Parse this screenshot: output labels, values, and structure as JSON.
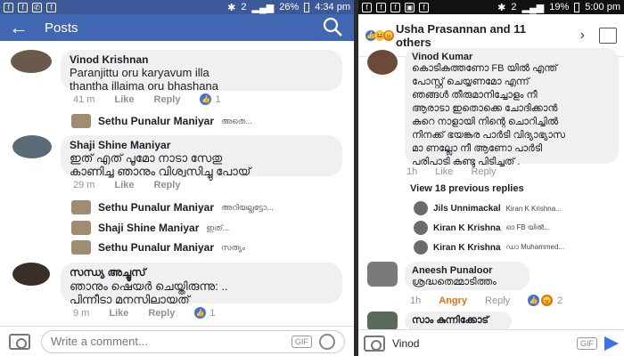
{
  "left": {
    "status": {
      "battery": "26%",
      "time": "4:34 pm",
      "sim": "2"
    },
    "appbar": {
      "title": "Posts"
    },
    "comments": [
      {
        "name": "Vinod Krishnan",
        "text1": "Paranjittu oru karyavum illa",
        "text2": "thantha illaima oru bhashana",
        "time": "41 m",
        "like": "Like",
        "reply": "Reply",
        "count": "1"
      },
      {
        "name": "Shaji Shine Maniyar",
        "text1": "ഇത് എത് പൂമോ നാടാ സേതു",
        "text2": "കാണിച്ച ഞാനും വിശ്വസിച്ചു പോയ്",
        "time": "29 m",
        "like": "Like",
        "reply": "Reply"
      },
      {
        "name": "സന്ധ്യ അച്ചൂസ്",
        "text1": "ഞാനും ഷെയർ ചെയ്തിരുന്നു: ..",
        "text2": "പിന്നീടാ മനസിലായത്",
        "time": "9 m",
        "like": "Like",
        "reply": "Reply",
        "count": "1"
      }
    ],
    "replies": [
      {
        "name": "Sethu Punalur Maniyar",
        "text": "അതെ..."
      },
      {
        "name": "Sethu Punalur Maniyar",
        "text": "അറിയല്ലട്ടോ..."
      },
      {
        "name": "Shaji Shine Maniyar",
        "text": "ഇത്..."
      },
      {
        "name": "Sethu Punalur Maniyar",
        "text": "സത്യം"
      }
    ],
    "composer": {
      "placeholder": "Write a comment...",
      "gif": "GIF"
    }
  },
  "right": {
    "status": {
      "battery": "19%",
      "time": "5:00 pm",
      "sim": "2"
    },
    "header": {
      "title": "Usha Prasannan and 11 others"
    },
    "main_comment": {
      "name": "Vinod Kumar",
      "lines": [
        "കൊടികുത്തണോ FB യിൽ എന്ത്",
        "പോസ്റ്റ് ചെയ്യണമോ എന്ന്",
        "ഞങ്ങൾ തീരുമാനിച്ചോളം  നീ",
        "ആരാടാ ഇതൊക്കെ ചോദിക്കാൻ",
        "കുറെ നാളായി നിന്റെ ചൊറിച്ചിൽ",
        "നിനക്ക് ഭയങ്കര പാർടി വിദ്യാഭ്യാസ",
        "മാ ണല്ലോ നീ ആണോ പാർടി",
        "പരിപാടി  കണ്ടു പിടിച്ചത് ."
      ],
      "time": "1h",
      "like": "Like",
      "reply": "Reply"
    },
    "view_previous": "View 18 previous replies",
    "replies": [
      {
        "name": "Jils Unnimackal",
        "text": "Kiran K Krishna..."
      },
      {
        "name": "Kiran K Krishna",
        "text": "ഓ FB യിൽ..."
      },
      {
        "name": "Kiran K Krishna",
        "text": "ഡാ Muhammed..."
      }
    ],
    "second_comment": {
      "name": "Aneesh Punaloor",
      "text": "ശ്രദ്ധതെമ്മാടിത്തം",
      "time": "1h",
      "react": "Angry",
      "reply": "Reply",
      "count": "2"
    },
    "third_comment": {
      "name": "സാം കുന്നിക്കോട്"
    },
    "composer": {
      "value": "Vinod",
      "gif": "GIF"
    },
    "colors": {
      "angry": "#e9710f",
      "like": "#3b73e6",
      "brand": "#3b5998"
    }
  }
}
